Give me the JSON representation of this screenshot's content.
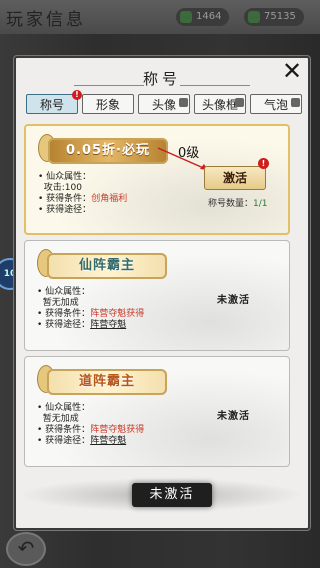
{
  "background": {
    "title": "玩家信息",
    "res1": "1464",
    "res2": "75135",
    "left_badge": "10"
  },
  "dialog": {
    "title": "称号",
    "tabs": [
      {
        "label": "称号",
        "active": true,
        "badge": "!"
      },
      {
        "label": "形象"
      },
      {
        "label": "头像"
      },
      {
        "label": "头像框"
      },
      {
        "label": "气泡"
      }
    ]
  },
  "cards": [
    {
      "banner": "0.05折·必玩",
      "level": "0级",
      "attr_title": "仙众属性：",
      "attr_value": "攻击:100",
      "condition_label": "获得条件：",
      "condition_value": "创角福利",
      "route_label": "获得途径：",
      "route_value": "",
      "button": "激活",
      "button_badge": "!",
      "count_label": "称号数量：",
      "count_value": "1/1"
    },
    {
      "banner": "仙阵霸主",
      "attr_title": "仙众属性：",
      "attr_value": "暂无加成",
      "condition_label": "获得条件：",
      "condition_value": "阵营夺魁获得",
      "route_label": "获得途径：",
      "route_value": "阵营夺魁",
      "status": "未激活"
    },
    {
      "banner": "道阵霸主",
      "attr_title": "仙众属性：",
      "attr_value": "暂无加成",
      "condition_label": "获得条件：",
      "condition_value": "阵营夺魁获得",
      "route_label": "获得途径：",
      "route_value": "阵营夺魁",
      "status": "未激活"
    }
  ],
  "bottom_button": "未激活"
}
